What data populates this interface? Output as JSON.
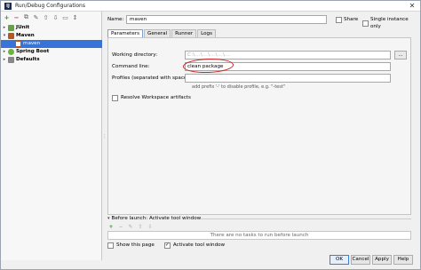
{
  "window": {
    "title": "Run/Debug Configurations",
    "app_icon_letter": "IJ"
  },
  "toolbar": {
    "add": "+",
    "remove": "−",
    "copy": "⧉",
    "edit": "✎",
    "up": "⇧",
    "down": "⇩",
    "folder": "▭",
    "sort": "↕"
  },
  "tree": [
    {
      "label": "JUnit",
      "bold": true,
      "arrow": "▸"
    },
    {
      "label": "Maven",
      "bold": true,
      "arrow": "▾"
    },
    {
      "label": "maven",
      "bold": false,
      "arrow": ""
    },
    {
      "label": "Spring Boot",
      "bold": true,
      "arrow": "▸"
    },
    {
      "label": "Defaults",
      "bold": true,
      "arrow": "▸"
    }
  ],
  "form": {
    "name_label": "Name:",
    "name_value": "maven",
    "share_label": "Share",
    "single_instance_label": "Single instance only"
  },
  "tabs": [
    "Parameters",
    "General",
    "Runner",
    "Logs"
  ],
  "parameters": {
    "working_dir_label": "Working directory:",
    "working_dir_value": "C:\\...\\...\\...\\...\\...",
    "browse": "...",
    "command_label": "Command line:",
    "command_value": "clean package",
    "profiles_label": "Profiles (separated with space):",
    "profiles_hint": "add prefix '-' to disable profile, e.g. \"-test\"",
    "resolve_label": "Resolve Workspace artifacts"
  },
  "before_launch": {
    "title": "Before launch: Activate tool window",
    "empty_text": "There are no tasks to run before launch",
    "show_page_label": "Show this page",
    "activate_label": "Activate tool window"
  },
  "buttons": {
    "ok": "OK",
    "cancel": "Cancel",
    "apply": "Apply",
    "help": "Help"
  }
}
